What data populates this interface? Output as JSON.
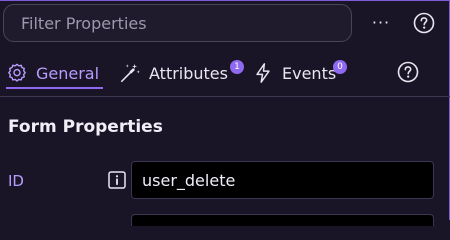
{
  "filter": {
    "placeholder": "Filter Properties"
  },
  "toolbar": {
    "more_label": "···",
    "more_icon": "ellipsis-icon",
    "help_icon": "help-circle-icon"
  },
  "tabs": [
    {
      "label": "General",
      "icon": "gear-icon",
      "active": true
    },
    {
      "label": "Attributes",
      "icon": "magic-wand-icon",
      "badge": "1"
    },
    {
      "label": "Events",
      "icon": "lightning-icon",
      "badge": "0"
    }
  ],
  "section": {
    "title": "Form Properties"
  },
  "fields": [
    {
      "label": "ID",
      "value": "user_delete",
      "icon": "info-icon"
    }
  ],
  "colors": {
    "accent": "#8f6af0",
    "active_text": "#b79cff",
    "background": "#1a1526",
    "input_bg": "#000000"
  }
}
